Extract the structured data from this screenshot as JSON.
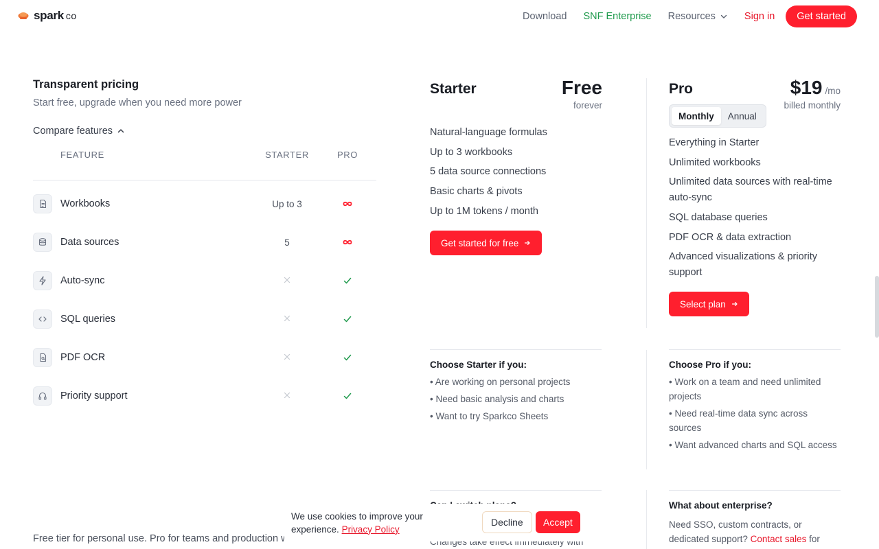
{
  "nav": {
    "logo_text": "spark",
    "logo_suffix": "co",
    "links": {
      "download": "Download",
      "enterprise": "SNF Enterprise",
      "resources": "Resources",
      "signin": "Sign in"
    },
    "cta": "Get started"
  },
  "pricing": {
    "title": "Transparent pricing",
    "subtitle": "Start free, upgrade when you need more power",
    "compare_label": "Compare features",
    "table": {
      "headers": [
        "FEATURE",
        "STARTER",
        "PRO"
      ],
      "rows": [
        {
          "feature": "Workbooks",
          "icon": "document-icon",
          "starter": "Up to 3",
          "pro": "infinity"
        },
        {
          "feature": "Data sources",
          "icon": "database-icon",
          "starter": "5",
          "pro": "infinity"
        },
        {
          "feature": "Auto-sync",
          "icon": "lightning-icon",
          "starter": "cross",
          "pro": "check"
        },
        {
          "feature": "SQL queries",
          "icon": "code-icon",
          "starter": "cross",
          "pro": "check"
        },
        {
          "feature": "PDF OCR",
          "icon": "file-scan-icon",
          "starter": "cross",
          "pro": "check"
        },
        {
          "feature": "Priority support",
          "icon": "headphones-icon",
          "starter": "cross",
          "pro": "check"
        }
      ]
    },
    "footer_note": "Free tier for personal use. Pro for teams and production workloads."
  },
  "starter": {
    "name": "Starter",
    "price": "Free",
    "price_note": "forever",
    "features": [
      "Natural-language formulas",
      "Up to 3 workbooks",
      "5 data source connections",
      "Basic charts & pivots",
      "Up to 1M tokens / month"
    ],
    "cta": "Get started for free",
    "choose_title": "Choose Starter if you:",
    "choose_bullets": [
      "• Are working on personal projects",
      "• Need basic analysis and charts",
      "• Want to try Sparkco Sheets"
    ],
    "faq_title": "Can I switch plans?",
    "faq_text": "Changes take effect immediately with"
  },
  "pro": {
    "name": "Pro",
    "price": "$19",
    "price_unit": "/mo",
    "price_note": "billed monthly",
    "toggle": {
      "monthly": "Monthly",
      "annual": "Annual",
      "selected": "Monthly"
    },
    "features": [
      "Everything in Starter",
      "Unlimited workbooks",
      "Unlimited data sources with real-time auto-sync",
      "SQL database queries",
      "PDF OCR & data extraction",
      "Advanced visualizations & priority support"
    ],
    "cta": "Select plan",
    "choose_title": "Choose Pro if you:",
    "choose_bullets": [
      "• Work on a team and need unlimited projects",
      "• Need real-time data sync across sources",
      "• Want advanced charts and SQL access"
    ],
    "faq_title": "What about enterprise?",
    "faq_text_before": "Need SSO, custom contracts, or dedicated support?",
    "faq_link": "Contact sales",
    "faq_text_after": "for"
  },
  "cookie": {
    "text": "We use cookies to improve your experience.",
    "link": "Privacy Policy",
    "decline": "Decline",
    "accept": "Accept"
  },
  "colors": {
    "accent": "#ff1f2e",
    "enterprise": "#1f9a4c",
    "check": "#1f9a4c"
  }
}
